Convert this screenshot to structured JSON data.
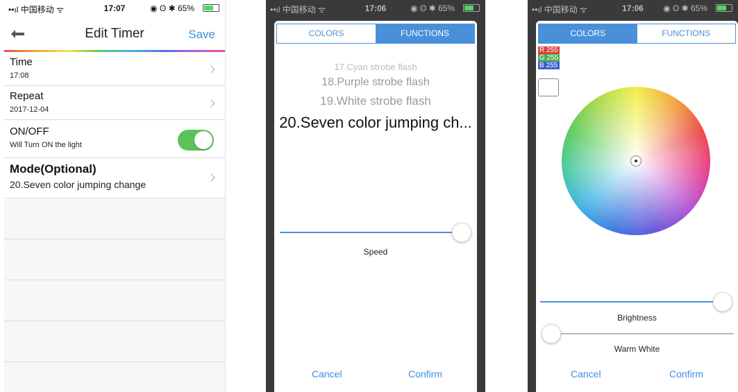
{
  "phone1": {
    "status": {
      "carrier": "••ıl 中国移动 ᯤ",
      "time": "17:07",
      "icons": "◉ ʘ ✱ 65%",
      "battery_level": 0.65
    },
    "title": "Edit Timer",
    "save_label": "Save",
    "rows": [
      {
        "title": "Time",
        "value": "17:08"
      },
      {
        "title": "Repeat",
        "value": "2017-12-04"
      },
      {
        "title": "ON/OFF",
        "value": "Will Turn ON the light",
        "toggle_on": true
      },
      {
        "title": "Mode(Optional)",
        "value": "20.Seven color jumping change"
      }
    ]
  },
  "phone2": {
    "status": {
      "carrier": "••ıl 中国移动 ᯤ",
      "time": "17:06",
      "icons": "◉ ʘ ✱ 65%",
      "battery_level": 0.65
    },
    "tabs": [
      "COLORS",
      "FUNCTIONS"
    ],
    "active_tab": "FUNCTIONS",
    "picker_items": [
      "17.Cyan strobe flash",
      "18.Purple strobe flash",
      "19.White strobe flash",
      "20.Seven color jumping ch..."
    ],
    "speed_label": "Speed",
    "speed_value": 1.0,
    "cancel_label": "Cancel",
    "confirm_label": "Confirm"
  },
  "phone3": {
    "status": {
      "carrier": "••ıl 中国移动 ᯤ",
      "time": "17:06",
      "icons": "◉ ʘ ✱ 65%",
      "battery_level": 0.65
    },
    "tabs": [
      "COLORS",
      "FUNCTIONS"
    ],
    "active_tab": "COLORS",
    "rgb": {
      "r": "R 255",
      "g": "G 255",
      "b": "B 255"
    },
    "brightness_label": "Brightness",
    "brightness_value": 1.0,
    "warm_white_label": "Warm White",
    "warm_white_value": 0.0,
    "cancel_label": "Cancel",
    "confirm_label": "Confirm"
  },
  "colors": {
    "accent": "#3d8ee3",
    "toggle_on": "#5cc35a",
    "dialog_bg": "#3a3a3a"
  }
}
